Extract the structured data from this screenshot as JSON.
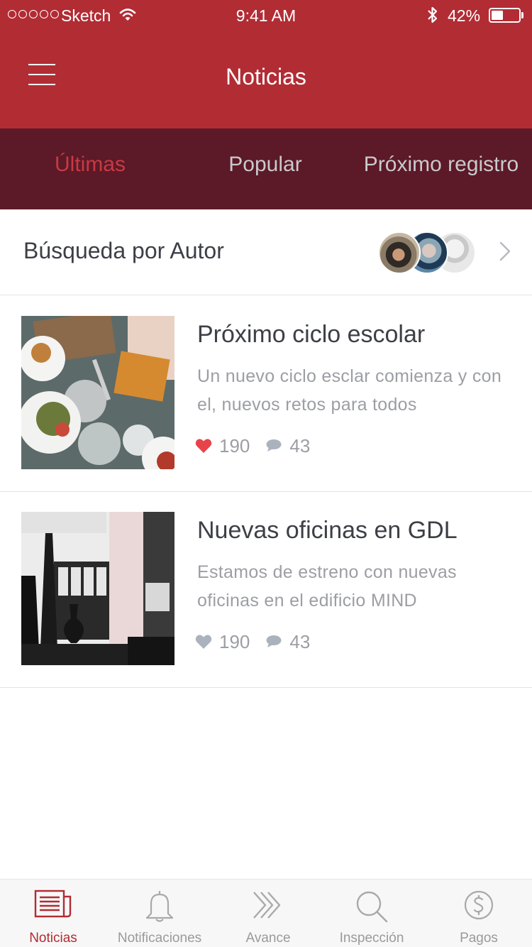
{
  "status_bar": {
    "carrier": "Sketch",
    "time": "9:41 AM",
    "battery_percent": "42%",
    "battery_level": 0.42
  },
  "header": {
    "title": "Noticias",
    "menu_icon": "hamburger-menu-icon"
  },
  "tabs": [
    {
      "label": "Últimas",
      "active": true
    },
    {
      "label": "Popular",
      "active": false
    },
    {
      "label": "Próximo registro",
      "active": false
    }
  ],
  "author_search": {
    "label": "Búsqueda por Autor",
    "avatar_count": 3
  },
  "articles": [
    {
      "title": "Próximo ciclo escolar",
      "description": "Un nuevo ciclo esclar comienza y con el, nuevos retos para todos",
      "likes": "190",
      "comments": "43",
      "liked": true
    },
    {
      "title": "Nuevas oficinas en GDL",
      "description": "Estamos de estreno con nuevas oficinas en el edificio MIND",
      "likes": "190",
      "comments": "43",
      "liked": false
    }
  ],
  "tabbar": [
    {
      "label": "Noticias",
      "icon": "newspaper-icon",
      "active": true
    },
    {
      "label": "Notificaciones",
      "icon": "bell-icon",
      "active": false
    },
    {
      "label": "Avance",
      "icon": "chevrons-right-icon",
      "active": false
    },
    {
      "label": "Inspección",
      "icon": "magnifier-icon",
      "active": false
    },
    {
      "label": "Pagos",
      "icon": "dollar-coin-icon",
      "active": false
    }
  ],
  "colors": {
    "header": "#b22c34",
    "tabs_background": "#5c1928",
    "active_tab": "#c83a41",
    "like_active": "#e8434b",
    "icon_gray": "#aab3bd"
  }
}
